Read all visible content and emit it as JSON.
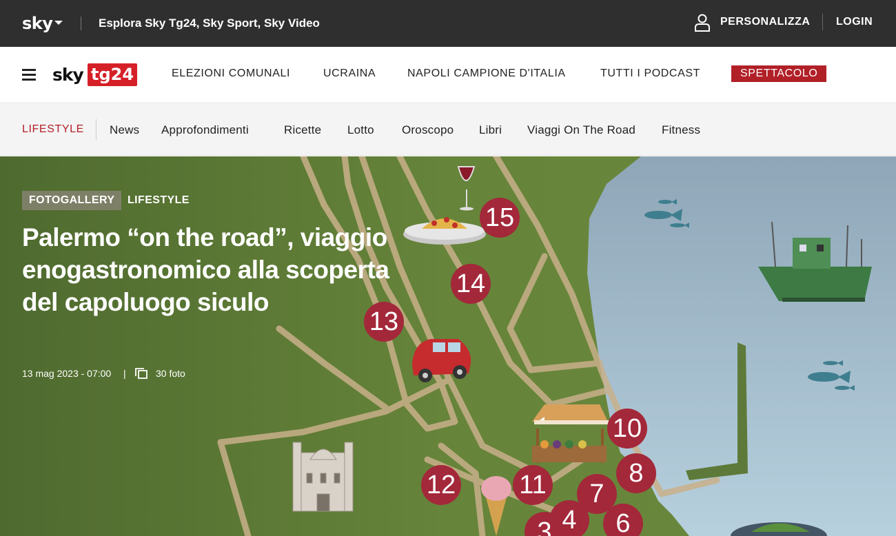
{
  "topbar": {
    "logo": "sky",
    "explore_label": "Esplora Sky Tg24, Sky Sport, Sky Video",
    "personalize_label": "PERSONALIZZA",
    "login_label": "LOGIN"
  },
  "mainnav": {
    "brand_sky": "sky",
    "brand_tg": "tg24",
    "items": [
      {
        "label": "ELEZIONI COMUNALI"
      },
      {
        "label": "UCRAINA"
      },
      {
        "label": "NAPOLI CAMPIONE D'ITALIA"
      },
      {
        "label": "TUTTI I PODCAST"
      },
      {
        "label": "SPETTACOLO"
      }
    ]
  },
  "subnav": {
    "section": "LIFESTYLE",
    "items": [
      {
        "label": "News"
      },
      {
        "label": "Approfondimenti"
      },
      {
        "label": "Ricette"
      },
      {
        "label": "Lotto"
      },
      {
        "label": "Oroscopo"
      },
      {
        "label": "Libri"
      },
      {
        "label": "Viaggi On The Road"
      },
      {
        "label": "Fitness"
      }
    ]
  },
  "article": {
    "tag_primary": "FOTOGALLERY",
    "tag_secondary": "LIFESTYLE",
    "title": "Palermo “on the road”, viaggio enogastronomico alla scoperta del capoluogo siculo",
    "date": "13 mag 2023 - 07:00",
    "separator": "|",
    "photo_count": "30 foto"
  },
  "map_markers": [
    "15",
    "14",
    "13",
    "10",
    "8",
    "12",
    "11",
    "7",
    "4",
    "6",
    "3"
  ],
  "colors": {
    "topbar_bg": "#2f2f2f",
    "brand_red": "#d62028",
    "accent_red": "#b11f27",
    "marker_red": "#a3283a",
    "land_green": "#5e7a3a",
    "sea_blue": "#a9c5d6"
  }
}
